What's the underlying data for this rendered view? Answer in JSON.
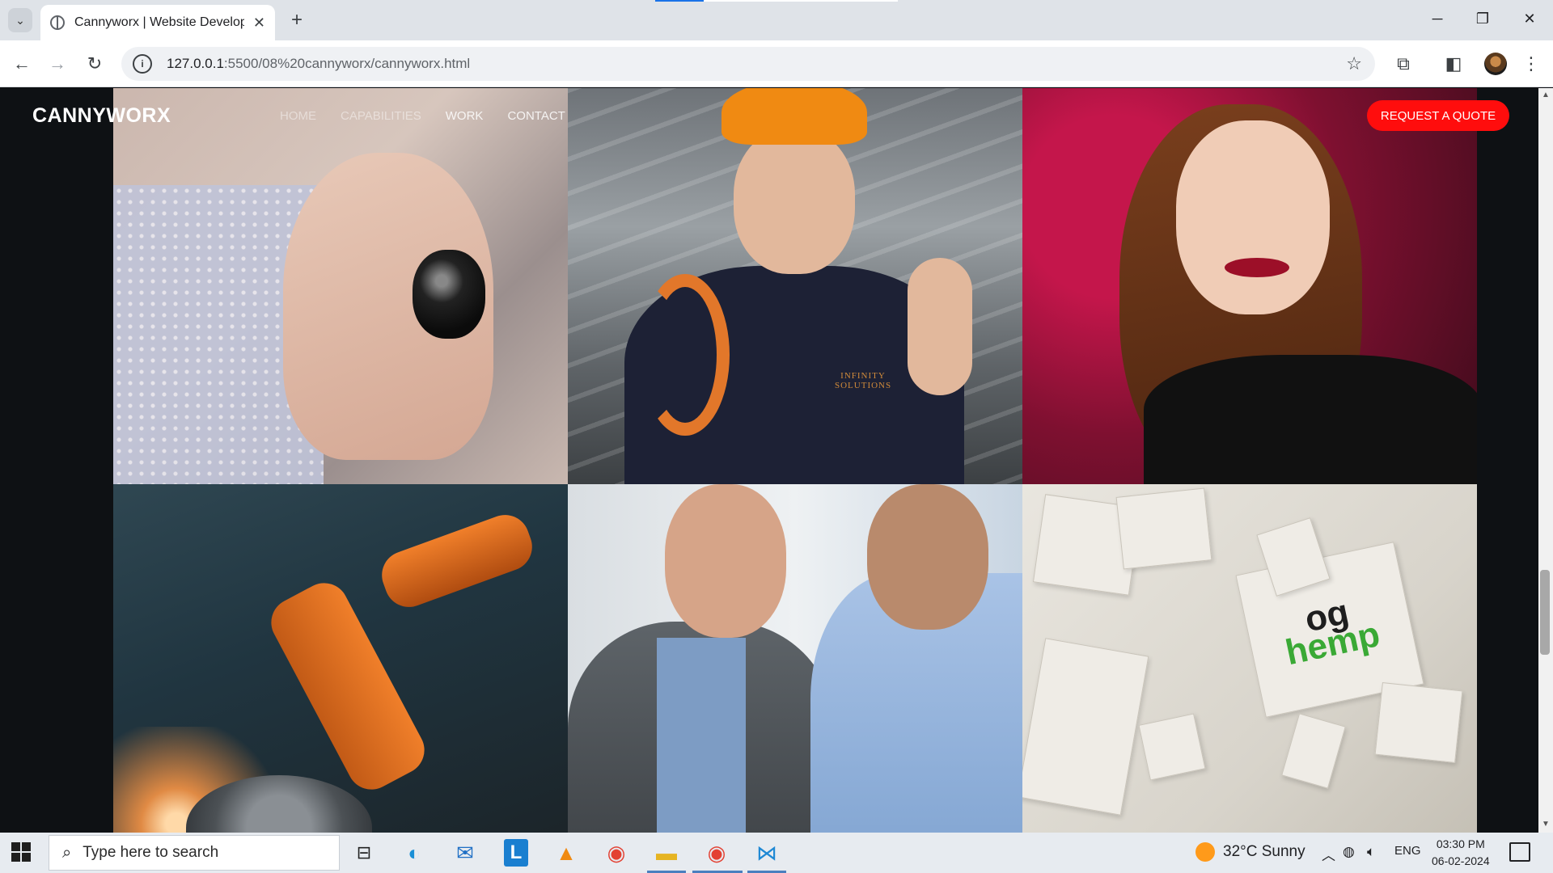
{
  "browser": {
    "tab_title": "Cannyworx | Website Developm",
    "tab_close": "✕",
    "new_tab": "+",
    "url_host": "127.0.0.1",
    "url_path": ":5500/08%20cannyworx/cannyworx.html",
    "window_controls": [
      "─",
      "❐",
      "✕"
    ]
  },
  "site": {
    "logo": "CANNYWORX",
    "nav": [
      {
        "label": "HOME",
        "faded": true
      },
      {
        "label": "CAPABILITIES",
        "faded": true
      },
      {
        "label": "WORK",
        "faded": false
      },
      {
        "label": "CONTACT",
        "faded": false
      }
    ],
    "cta": "REQUEST A QUOTE"
  },
  "gallery": {
    "tiles": [
      {
        "icon": "jewelry-ring-photo"
      },
      {
        "icon": "worker-thumbs-up-photo",
        "badge": "INFINITY SOLUTIONS"
      },
      {
        "icon": "smiling-woman-photo"
      },
      {
        "icon": "industrial-robot-arm-photo"
      },
      {
        "icon": "business-handshake-photo"
      },
      {
        "icon": "og-hemp-packaging-photo",
        "brand_top": "og",
        "brand_bottom": "hemp"
      }
    ]
  },
  "taskbar": {
    "search_placeholder": "Type here to search",
    "weather": "32°C  Sunny",
    "language": "ENG",
    "time": "03:30 PM",
    "date": "06-02-2024"
  },
  "colors": {
    "cta": "#ff0d0d",
    "page_bg": "#0e1114",
    "taskbar": "#e7ebf0"
  }
}
